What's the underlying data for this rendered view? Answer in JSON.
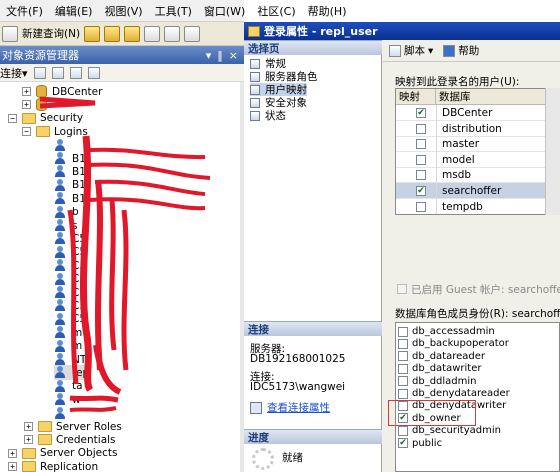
{
  "menubar": [
    "文件(F)",
    "编辑(E)",
    "视图(V)",
    "工具(T)",
    "窗口(W)",
    "社区(C)",
    "帮助(H)"
  ],
  "toolbar": {
    "new_query": "新建查询(N)"
  },
  "object_explorer": {
    "title": "对象资源管理器",
    "title_buttons": [
      "▾",
      "‖",
      "×"
    ],
    "connect_label": "连接▾",
    "tree": [
      {
        "label": "DBCenter",
        "type": "db",
        "expander": "+"
      },
      {
        "label": "",
        "type": "db",
        "expander": "+"
      },
      {
        "label": "Security",
        "type": "folder",
        "expander": "−"
      },
      {
        "label": "Logins",
        "type": "folder",
        "expander": "−"
      },
      {
        "label": "",
        "type": "user"
      },
      {
        "label": "B1",
        "type": "user"
      },
      {
        "label": "B1",
        "type": "user"
      },
      {
        "label": "B1",
        "type": "user"
      },
      {
        "label": "B1",
        "type": "user"
      },
      {
        "label": "b",
        "type": "user"
      },
      {
        "label": "s",
        "type": "user"
      },
      {
        "label": "C5",
        "type": "user"
      },
      {
        "label": "C5",
        "type": "user"
      },
      {
        "label": "C5",
        "type": "user"
      },
      {
        "label": "C5",
        "type": "user"
      },
      {
        "label": "C5",
        "type": "user"
      },
      {
        "label": "C5",
        "type": "user"
      },
      {
        "label": "C5",
        "type": "user"
      },
      {
        "label": "m",
        "type": "user"
      },
      {
        "label": "m",
        "type": "user"
      },
      {
        "label": "NT",
        "type": "user"
      },
      {
        "label": "rep",
        "type": "user",
        "selected": true
      },
      {
        "label": "ta",
        "type": "user"
      },
      {
        "label": "w",
        "type": "user"
      },
      {
        "label": "",
        "type": "user"
      },
      {
        "label": "Server Roles",
        "type": "folder",
        "expander": "+"
      },
      {
        "label": "Credentials",
        "type": "folder",
        "expander": "+"
      },
      {
        "label": "Server Objects",
        "type": "folder",
        "expander": "+"
      },
      {
        "label": "Replication",
        "type": "folder",
        "expander": "+"
      }
    ]
  },
  "dialog": {
    "title": "登录属性 - repl_user",
    "select_page_header": "选择页",
    "pages": [
      "常规",
      "服务器角色",
      "用户映射",
      "安全对象",
      "状态"
    ],
    "active_page": "用户映射",
    "toolbar": {
      "script": "脚本",
      "help": "帮助"
    },
    "connection_header": "连接",
    "server_label": "服务器:",
    "server_value": "DB192168001025",
    "connection_label": "连接:",
    "connection_value": "IDC5173\\wangwei",
    "view_conn_link": "查看连接属性",
    "progress_header": "进度",
    "progress_status": "就绪",
    "mapping_label": "映射到此登录名的用户(U):",
    "mapping_columns": [
      "映射",
      "数据库"
    ],
    "mapping_rows": [
      {
        "mapped": true,
        "db": "DBCenter"
      },
      {
        "mapped": false,
        "db": "distribution"
      },
      {
        "mapped": false,
        "db": "master"
      },
      {
        "mapped": false,
        "db": "model"
      },
      {
        "mapped": false,
        "db": "msdb"
      },
      {
        "mapped": true,
        "db": "searchoffer",
        "highlight": true
      },
      {
        "mapped": false,
        "db": "tempdb"
      }
    ],
    "guest_label": "已启用 Guest 帐户: searchoffer",
    "roles_label": "数据库角色成员身份(R): searchoffer",
    "roles": [
      {
        "name": "db_accessadmin",
        "checked": false
      },
      {
        "name": "db_backupoperator",
        "checked": false
      },
      {
        "name": "db_datareader",
        "checked": false
      },
      {
        "name": "db_datawriter",
        "checked": false
      },
      {
        "name": "db_ddladmin",
        "checked": false
      },
      {
        "name": "db_denydatareader",
        "checked": false
      },
      {
        "name": "db_denydatawriter",
        "checked": false
      },
      {
        "name": "db_owner",
        "checked": true
      },
      {
        "name": "db_securityadmin",
        "checked": false
      },
      {
        "name": "public",
        "checked": true
      }
    ]
  },
  "colors": {
    "title_blue": "#0a2f90",
    "annotation_red": "#d43a3a",
    "scribble_red": "#e0182a"
  }
}
